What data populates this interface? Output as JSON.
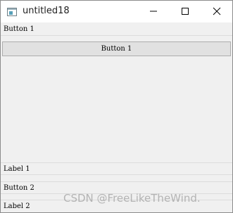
{
  "window": {
    "title": "untitled18",
    "app_icon": "qt-window-icon",
    "controls": {
      "minimize_icon": "minimize-icon",
      "maximize_icon": "maximize-icon",
      "close_icon": "close-icon"
    }
  },
  "toolbar": {
    "button1_label": "Button 1"
  },
  "main": {
    "push_button_label": "Button 1"
  },
  "bottom": {
    "label1_text": "Label 1",
    "button2_label": "Button 2",
    "label2_text": "Label 2"
  },
  "watermark": "CSDN @FreeLikeTheWind."
}
